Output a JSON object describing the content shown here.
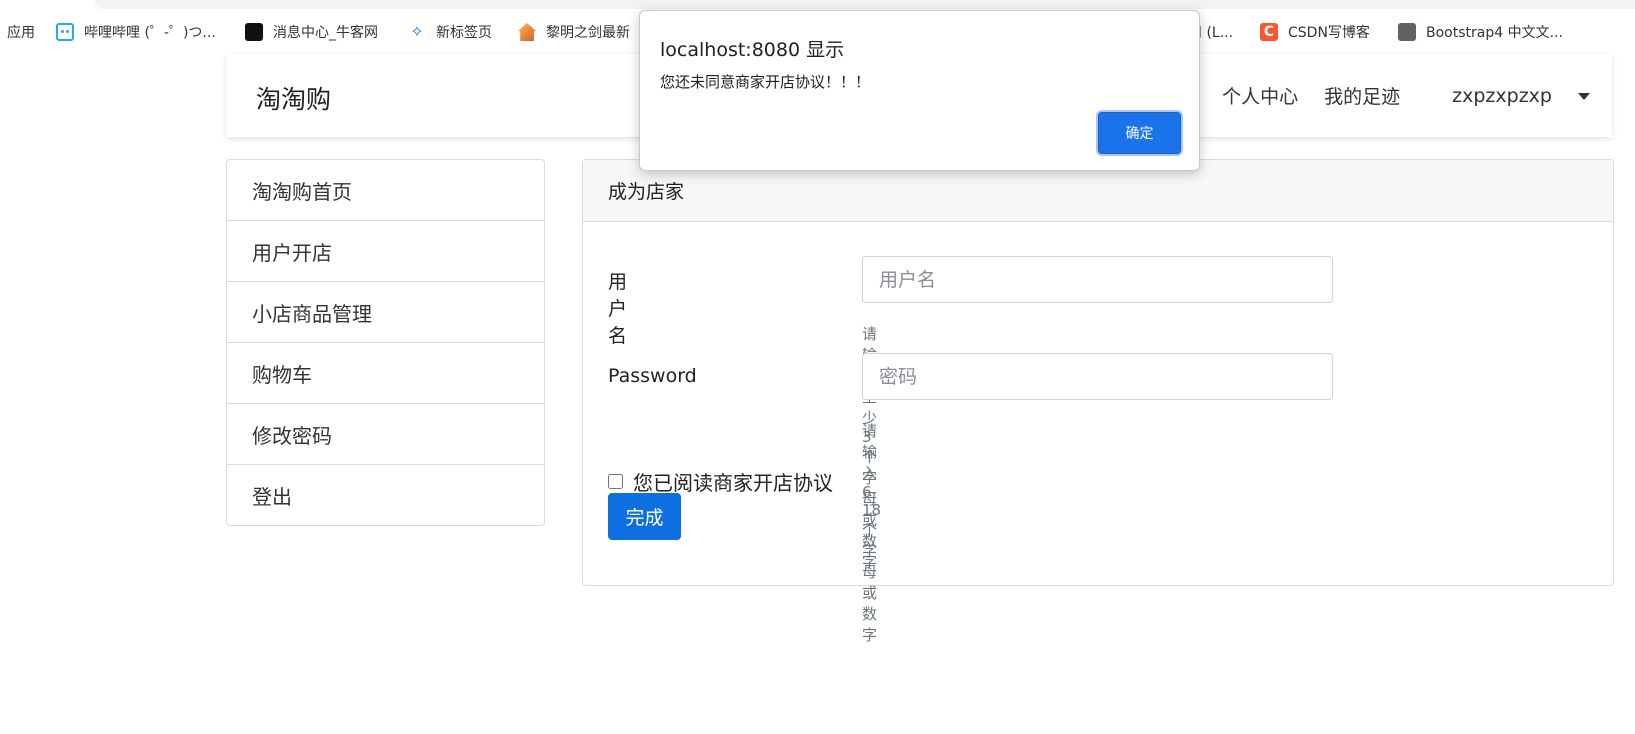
{
  "browser": {
    "bookmarks": {
      "apps": "应用",
      "items": [
        {
          "label": "哔哩哔哩 (゜-゜)つ...",
          "icon": "bilibili-icon"
        },
        {
          "label": "消息中心_牛客网",
          "icon": "nowcoder-icon"
        },
        {
          "label": "新标签页",
          "icon": "new-tab-icon"
        },
        {
          "label": "黎明之剑最新",
          "icon": "house-icon"
        },
        {
          "label": "扣 (L...",
          "icon": ""
        },
        {
          "label": "CSDN写博客",
          "icon": "csdn-icon"
        },
        {
          "label": "Bootstrap4 中文文...",
          "icon": "globe-icon"
        }
      ]
    }
  },
  "navbar": {
    "brand": "淘淘购",
    "links": [
      "个人中心",
      "我的足迹"
    ],
    "user": "zxpzxpzxp"
  },
  "sidebar": {
    "items": [
      {
        "label": "淘淘购首页"
      },
      {
        "label": "用户开店"
      },
      {
        "label": "小店商品管理"
      },
      {
        "label": "购物车"
      },
      {
        "label": "修改密码"
      },
      {
        "label": "登出"
      }
    ]
  },
  "card": {
    "header": "成为店家",
    "username": {
      "label": "用户名",
      "placeholder": "用户名",
      "value": "",
      "help": "请输入至少3个字母或数字"
    },
    "password": {
      "label": "Password",
      "placeholder": "密码",
      "value": "",
      "help": "请输入6-18个字母或数字"
    },
    "agreement": {
      "label": "您已阅读商家开店协议",
      "checked": false
    },
    "submit": "完成"
  },
  "dialog": {
    "title": "localhost:8080 显示",
    "message": "您还未同意商家开店协议！！！",
    "ok": "确定"
  },
  "colors": {
    "primary": "#0d6fe0",
    "dialog_button": "#1a73e8"
  }
}
